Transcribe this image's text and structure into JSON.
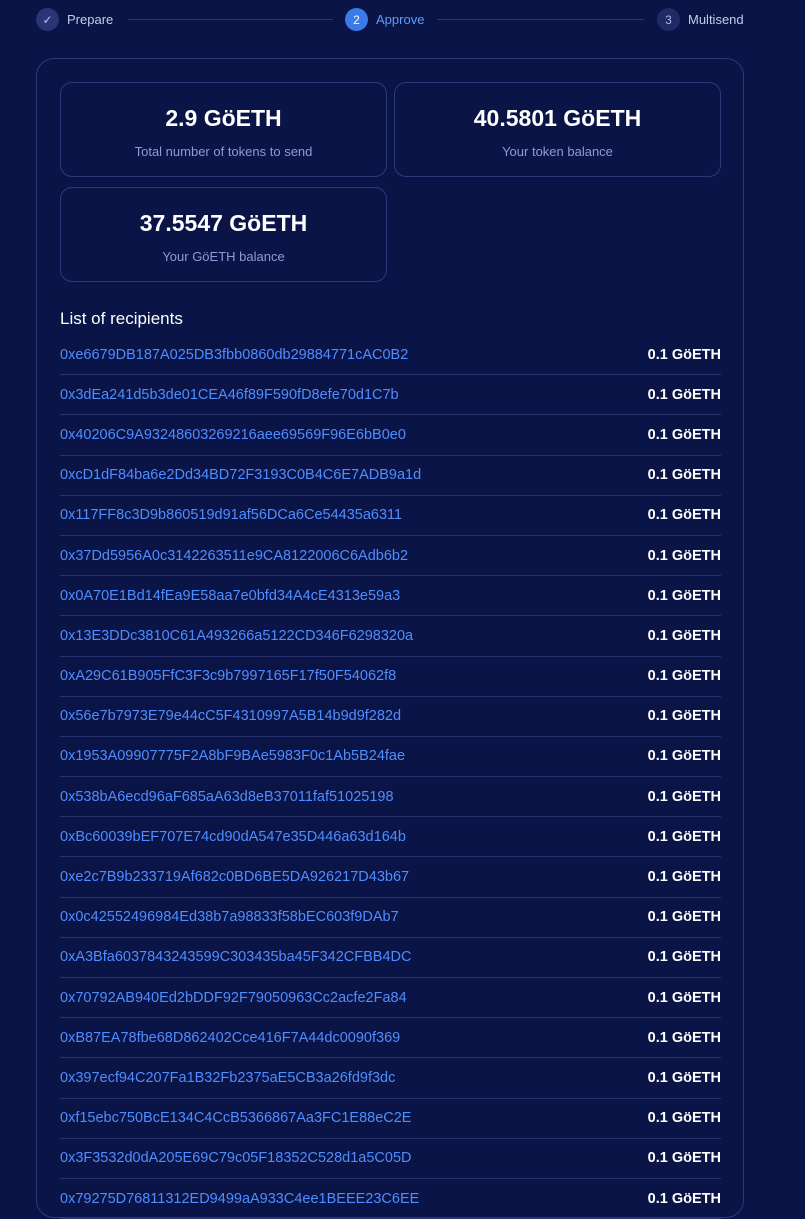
{
  "stepper": {
    "steps": [
      {
        "number": "✓",
        "label": "Prepare"
      },
      {
        "number": "2",
        "label": "Approve"
      },
      {
        "number": "3",
        "label": "Multisend"
      }
    ]
  },
  "stats": {
    "total_tokens": {
      "value": "2.9 GöETH",
      "label": "Total number of tokens to send"
    },
    "token_balance": {
      "value": "40.5801 GöETH",
      "label": "Your token balance"
    },
    "eth_balance": {
      "value": "37.5547 GöETH",
      "label": "Your GöETH balance"
    }
  },
  "recipients": {
    "title": "List of recipients",
    "items": [
      {
        "address": "0xe6679DB187A025DB3fbb0860db29884771cAC0B2",
        "amount": "0.1 GöETH"
      },
      {
        "address": "0x3dEa241d5b3de01CEA46f89F590fD8efe70d1C7b",
        "amount": "0.1 GöETH"
      },
      {
        "address": "0x40206C9A93248603269216aee69569F96E6bB0e0",
        "amount": "0.1 GöETH"
      },
      {
        "address": "0xcD1dF84ba6e2Dd34BD72F3193C0B4C6E7ADB9a1d",
        "amount": "0.1 GöETH"
      },
      {
        "address": "0x117FF8c3D9b860519d91af56DCa6Ce54435a6311",
        "amount": "0.1 GöETH"
      },
      {
        "address": "0x37Dd5956A0c3142263511e9CA8122006C6Adb6b2",
        "amount": "0.1 GöETH"
      },
      {
        "address": "0x0A70E1Bd14fEa9E58aa7e0bfd34A4cE4313e59a3",
        "amount": "0.1 GöETH"
      },
      {
        "address": "0x13E3DDc3810C61A493266a5122CD346F6298320a",
        "amount": "0.1 GöETH"
      },
      {
        "address": "0xA29C61B905FfC3F3c9b7997165F17f50F54062f8",
        "amount": "0.1 GöETH"
      },
      {
        "address": "0x56e7b7973E79e44cC5F4310997A5B14b9d9f282d",
        "amount": "0.1 GöETH"
      },
      {
        "address": "0x1953A09907775F2A8bF9BAe5983F0c1Ab5B24fae",
        "amount": "0.1 GöETH"
      },
      {
        "address": "0x538bA6ecd96aF685aA63d8eB37011faf51025198",
        "amount": "0.1 GöETH"
      },
      {
        "address": "0xBc60039bEF707E74cd90dA547e35D446a63d164b",
        "amount": "0.1 GöETH"
      },
      {
        "address": "0xe2c7B9b233719Af682c0BD6BE5DA926217D43b67",
        "amount": "0.1 GöETH"
      },
      {
        "address": "0x0c42552496984Ed38b7a98833f58bEC603f9DAb7",
        "amount": "0.1 GöETH"
      },
      {
        "address": "0xA3Bfa6037843243599C303435ba45F342CFBB4DC",
        "amount": "0.1 GöETH"
      },
      {
        "address": "0x70792AB940Ed2bDDF92F79050963Cc2acfe2Fa84",
        "amount": "0.1 GöETH"
      },
      {
        "address": "0xB87EA78fbe68D862402Cce416F7A44dc0090f369",
        "amount": "0.1 GöETH"
      },
      {
        "address": "0x397ecf94C207Fa1B32Fb2375aE5CB3a26fd9f3dc",
        "amount": "0.1 GöETH"
      },
      {
        "address": "0xf15ebc750BcE134C4CcB5366867Aa3FC1E88eC2E",
        "amount": "0.1 GöETH"
      },
      {
        "address": "0x3F3532d0dA205E69C79c05F18352C528d1a5C05D",
        "amount": "0.1 GöETH"
      },
      {
        "address": "0x79275D76811312ED9499aA933C4ee1BEEE23C6EE",
        "amount": "0.1 GöETH"
      }
    ]
  }
}
